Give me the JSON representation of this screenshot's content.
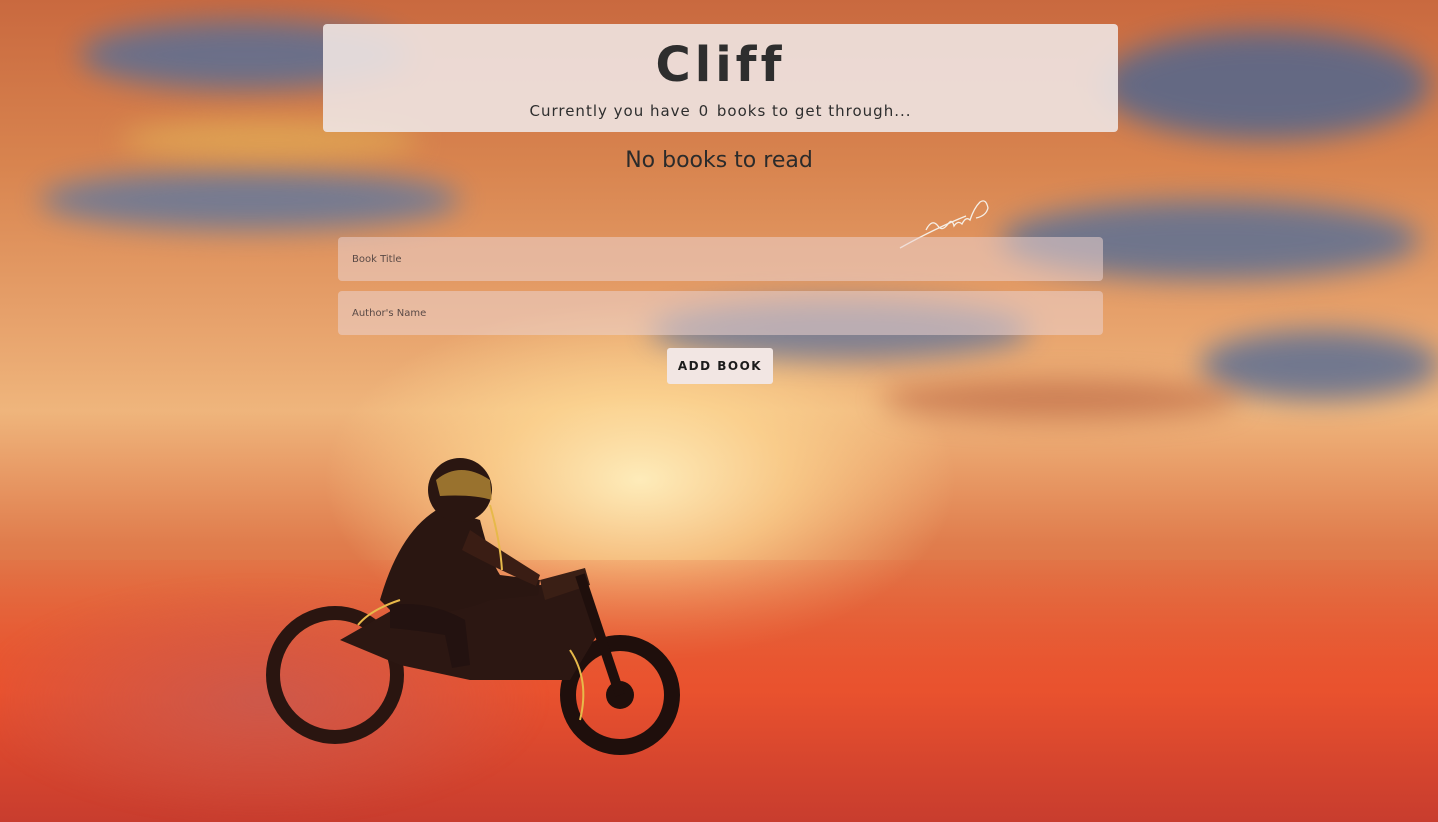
{
  "header": {
    "title": "Cliff",
    "subtitle_prefix": "Currently you have",
    "book_count": "0",
    "subtitle_suffix": "books to get through..."
  },
  "list": {
    "empty_message": "No books to read"
  },
  "form": {
    "title_placeholder": "Book Title",
    "title_value": "",
    "author_placeholder": "Author's Name",
    "author_value": "",
    "submit_label": "ADD BOOK"
  },
  "background": {
    "signature": "Swamp"
  }
}
